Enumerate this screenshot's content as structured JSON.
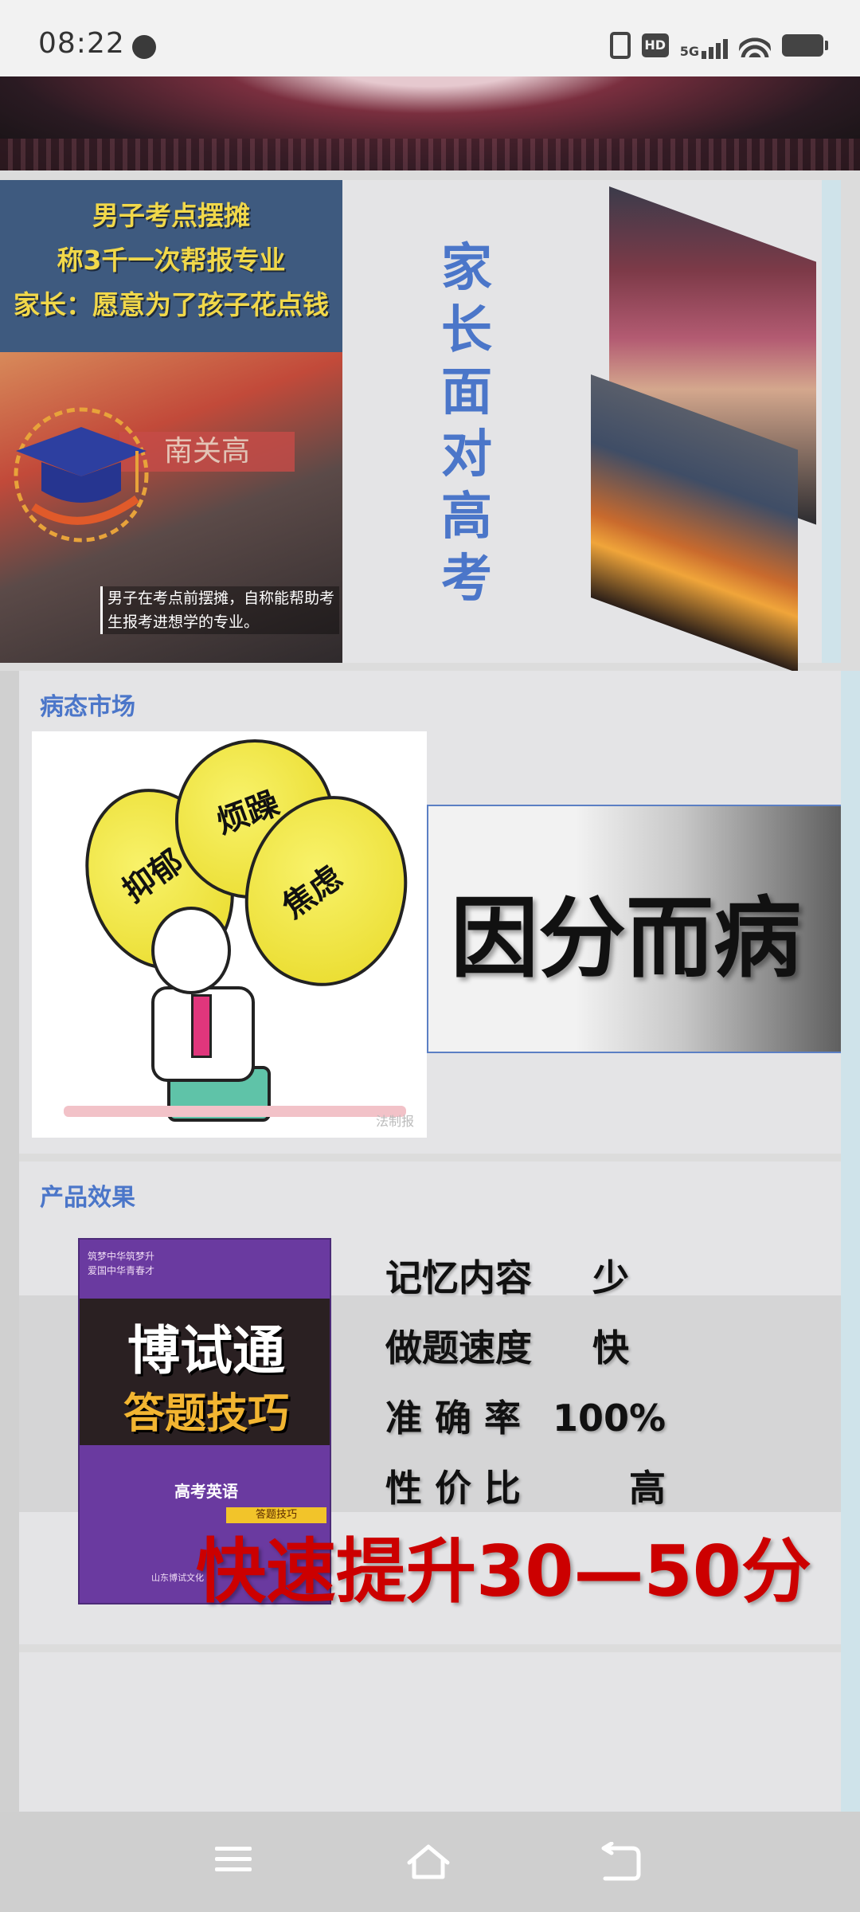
{
  "status_bar": {
    "time": "08:22",
    "network": "5G",
    "hd": "HD",
    "icons": [
      "vibrate-icon",
      "hd-icon",
      "signal-5g-icon",
      "wifi-icon",
      "battery-icon"
    ]
  },
  "slide1": {
    "news_headline": [
      "男子考点摆摊",
      "称3千一次帮报专业",
      "家长：愿意为了孩子花点钱"
    ],
    "news_sign": "南关高",
    "news_caption": "男子在考点前摆摊，自称能帮助考生报考进想学的专业。",
    "vertical_title": "家长面对高考"
  },
  "slide2": {
    "section_label": "病态市场",
    "pear_words": [
      "抑郁",
      "烦躁",
      "焦虑"
    ],
    "watermark": "法制报",
    "banner": "因分而病"
  },
  "slide3": {
    "section_label": "产品效果",
    "book": {
      "top_line1": "筑梦中华筑梦升",
      "top_line2": "爱国中华青春才",
      "title": "博试通",
      "subtitle": "答题技巧",
      "subject": "高考英语",
      "tag": "答题技巧",
      "publisher": "山东博试文化"
    },
    "features": [
      {
        "label": "记忆内容",
        "value": "少"
      },
      {
        "label": "做题速度",
        "value": "快"
      },
      {
        "label": "准 确 率",
        "value": "100%"
      },
      {
        "label": "性 价 比",
        "value": "高"
      }
    ],
    "promo": "快速提升30—50分"
  },
  "colors": {
    "accent_blue": "#4b76c9",
    "promo_red": "#cc0000",
    "headline_yellow": "#f1d84a"
  }
}
